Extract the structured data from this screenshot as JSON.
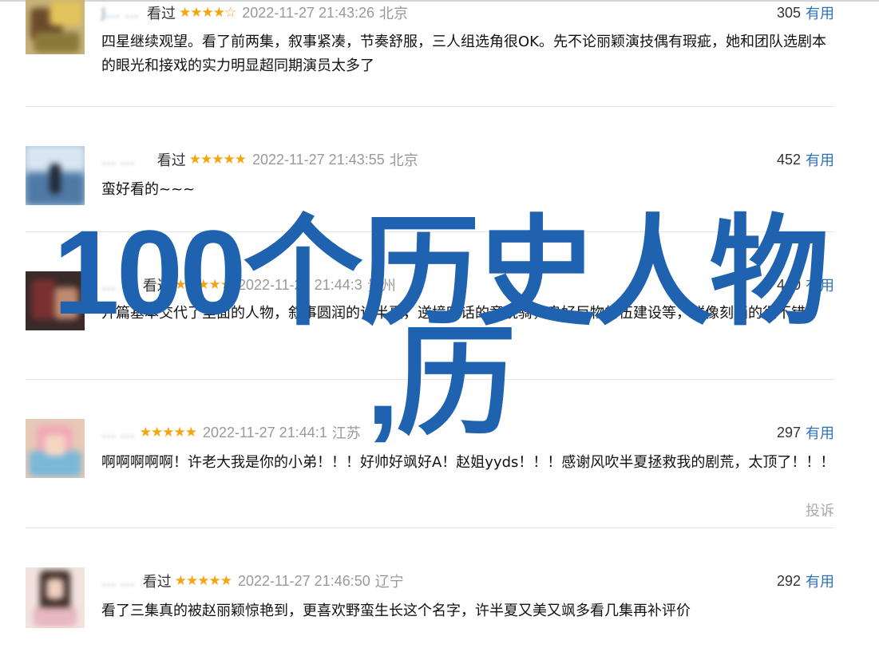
{
  "comments": [
    {
      "username": "J… …",
      "status": "看过",
      "stars": "★★★★☆",
      "time": "2022-11-27 21:43:26",
      "location": "北京",
      "votes": "305",
      "useful_label": "有用",
      "text": "四星继续观望。看了前两集，叙事紧凑，节奏舒服，三人组选角很OK。先不论丽颖演技偶有瑕疵，她和团队选剧本的眼光和接戏的实力明显超同期演员太多了"
    },
    {
      "username": "… …",
      "status": "看过",
      "stars": "★★★★★",
      "time": "2022-11-27 21:43:55",
      "location": "北京",
      "votes": "452",
      "useful_label": "有用",
      "text": "蛮好看的~~~"
    },
    {
      "username": "… …",
      "status": "看过",
      "stars": "★★★★★",
      "time": "2022-11-27 21:44:3",
      "location": "贵州",
      "votes": "440",
      "useful_label": "有用",
      "text": "开篇基本交代了里面的人物，叙事圆润的许半夏，逆境听话的童晓骑，良好巨物的伍建设等，群像刻画的很不错"
    },
    {
      "username": "… …",
      "status": "",
      "stars": "★★★★★",
      "time": "2022-11-27 21:44:1",
      "location": "江苏",
      "votes": "297",
      "useful_label": "有用",
      "text": "啊啊啊啊啊！许老大我是你的小弟！！！好帅好飒好A！赵姐yyds！！！感谢风吹半夏拯救我的剧荒，太顶了！！！",
      "report_label": "投诉"
    },
    {
      "username": "… …",
      "status": "看过",
      "stars": "★★★★★",
      "time": "2022-11-27 21:46:50",
      "location": "辽宁",
      "votes": "292",
      "useful_label": "有用",
      "text": "看了三集真的被赵丽颖惊艳到，更喜欢野蛮生长这个名字，许半夏又美又飒多看几集再补评价"
    }
  ],
  "overlay": {
    "line1": "100个历史人物",
    "line2": ",历"
  },
  "colors": {
    "accent": "#2f73b8",
    "star": "#f6a510",
    "overlay": "#1f62b0",
    "meta": "#999999"
  }
}
